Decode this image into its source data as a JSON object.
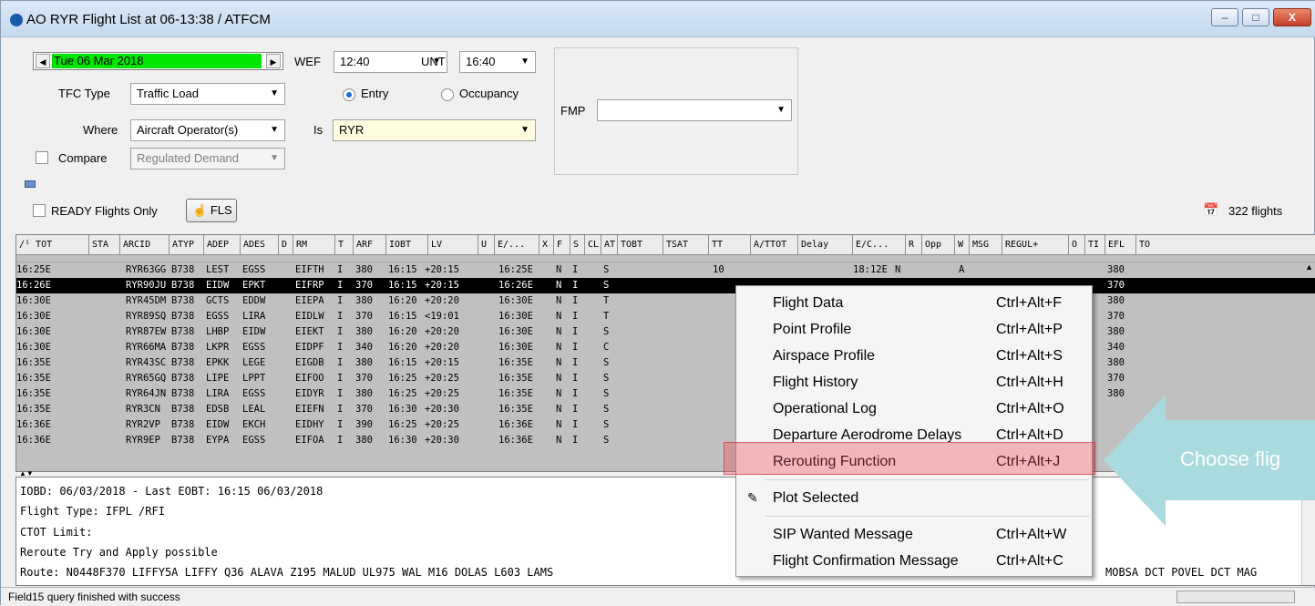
{
  "window": {
    "title": "AO RYR Flight List at 06-13:38 / ATFCM"
  },
  "filters": {
    "date": "Tue 06 Mar 2018",
    "wef_label": "WEF",
    "wef_value": "12:40",
    "unt_label": "UNT",
    "unt_value": "16:40",
    "tfc_type_label": "TFC Type",
    "tfc_type_value": "Traffic Load",
    "entry_label": "Entry",
    "occupancy_label": "Occupancy",
    "where_label": "Where",
    "where_value": "Aircraft Operator(s)",
    "is_label": "Is",
    "is_value": "RYR",
    "compare_label": "Compare",
    "compare_value": "Regulated Demand",
    "fmp_label": "FMP",
    "fmp_value": ""
  },
  "toolbar": {
    "ready_flights_label": "READY Flights Only",
    "fls_label": "FLS",
    "flight_count": "322 flights"
  },
  "columns": [
    "/¹ TOT",
    "STA",
    "ARCID",
    "ATYP",
    "ADEP",
    "ADES",
    "D",
    "RM",
    "T",
    "ARF",
    "IOBT",
    "LV",
    "U",
    "E/...",
    "X",
    "F",
    "S",
    "CL",
    "AT",
    "TOBT",
    "TSAT",
    "TT",
    "A/TTOT",
    "Delay",
    "E/C...",
    "R",
    "Opp",
    "W",
    "MSG",
    "REGUL+",
    "O",
    "TI",
    "EFL",
    "TO"
  ],
  "rows": [
    {
      "tot": "16:25E",
      "arcid": "RYR63GG",
      "atyp": "B738",
      "adep": "LEST",
      "ades": "EGSS",
      "rm": "EIFTH",
      "t": "I",
      "arf": "380",
      "iobt": "16:15",
      "lv": "+20:15",
      "e": "16:25E",
      "f": "N",
      "s": "I",
      "at": "S",
      "tt": "10",
      "ec": "18:12E",
      "r": "N",
      "w": "A",
      "efl": "380"
    },
    {
      "tot": "16:26E",
      "arcid": "RYR90JU",
      "atyp": "B738",
      "adep": "EIDW",
      "ades": "EPKT",
      "rm": "EIFRP",
      "t": "I",
      "arf": "370",
      "iobt": "16:15",
      "lv": "+20:15",
      "e": "16:26E",
      "f": "N",
      "s": "I",
      "at": "S",
      "tt": "",
      "ec": "",
      "r": "",
      "w": "",
      "efl": "370"
    },
    {
      "tot": "16:30E",
      "arcid": "RYR45DM",
      "atyp": "B738",
      "adep": "GCTS",
      "ades": "EDDW",
      "rm": "EIEPA",
      "t": "I",
      "arf": "380",
      "iobt": "16:20",
      "lv": "+20:20",
      "e": "16:30E",
      "f": "N",
      "s": "I",
      "at": "T",
      "tt": "",
      "ec": "",
      "r": "",
      "w": "",
      "efl": "380"
    },
    {
      "tot": "16:30E",
      "arcid": "RYR89SQ",
      "atyp": "B738",
      "adep": "EGSS",
      "ades": "LIRA",
      "rm": "EIDLW",
      "t": "I",
      "arf": "370",
      "iobt": "16:15",
      "lv": "<19:01",
      "e": "16:30E",
      "f": "N",
      "s": "I",
      "at": "T",
      "tt": "",
      "ec": "",
      "r": "",
      "w": "",
      "efl": "370"
    },
    {
      "tot": "16:30E",
      "arcid": "RYR87EW",
      "atyp": "B738",
      "adep": "LHBP",
      "ades": "EIDW",
      "rm": "EIEKT",
      "t": "I",
      "arf": "380",
      "iobt": "16:20",
      "lv": "+20:20",
      "e": "16:30E",
      "f": "N",
      "s": "I",
      "at": "S",
      "tt": "",
      "ec": "",
      "r": "",
      "w": "",
      "efl": "380"
    },
    {
      "tot": "16:30E",
      "arcid": "RYR66MA",
      "atyp": "B738",
      "adep": "LKPR",
      "ades": "EGSS",
      "rm": "EIDPF",
      "t": "I",
      "arf": "340",
      "iobt": "16:20",
      "lv": "+20:20",
      "e": "16:30E",
      "f": "N",
      "s": "I",
      "at": "C",
      "tt": "",
      "ec": "",
      "r": "",
      "w": "",
      "efl": "340"
    },
    {
      "tot": "16:35E",
      "arcid": "RYR43SC",
      "atyp": "B738",
      "adep": "EPKK",
      "ades": "LEGE",
      "rm": "EIGDB",
      "t": "I",
      "arf": "380",
      "iobt": "16:15",
      "lv": "+20:15",
      "e": "16:35E",
      "f": "N",
      "s": "I",
      "at": "S",
      "tt": "",
      "ec": "",
      "r": "",
      "w": "",
      "efl": "380"
    },
    {
      "tot": "16:35E",
      "arcid": "RYR65GQ",
      "atyp": "B738",
      "adep": "LIPE",
      "ades": "LPPT",
      "rm": "EIFOO",
      "t": "I",
      "arf": "370",
      "iobt": "16:25",
      "lv": "+20:25",
      "e": "16:35E",
      "f": "N",
      "s": "I",
      "at": "S",
      "tt": "",
      "ec": "",
      "r": "",
      "w": "",
      "efl": "370"
    },
    {
      "tot": "16:35E",
      "arcid": "RYR64JN",
      "atyp": "B738",
      "adep": "LIRA",
      "ades": "EGSS",
      "rm": "EIDYR",
      "t": "I",
      "arf": "380",
      "iobt": "16:25",
      "lv": "+20:25",
      "e": "16:35E",
      "f": "N",
      "s": "I",
      "at": "S",
      "tt": "",
      "ec": "",
      "r": "",
      "w": "",
      "efl": "380"
    },
    {
      "tot": "16:35E",
      "arcid": "RYR3CN",
      "atyp": "B738",
      "adep": "EDSB",
      "ades": "LEAL",
      "rm": "EIEFN",
      "t": "I",
      "arf": "370",
      "iobt": "16:30",
      "lv": "+20:30",
      "e": "16:35E",
      "f": "N",
      "s": "I",
      "at": "S",
      "tt": "",
      "ec": "",
      "r": "",
      "w": "",
      "efl": ""
    },
    {
      "tot": "16:36E",
      "arcid": "RYR2VP",
      "atyp": "B738",
      "adep": "EIDW",
      "ades": "EKCH",
      "rm": "EIDHY",
      "t": "I",
      "arf": "390",
      "iobt": "16:25",
      "lv": "+20:25",
      "e": "16:36E",
      "f": "N",
      "s": "I",
      "at": "S",
      "tt": "",
      "ec": "",
      "r": "",
      "w": "",
      "efl": ""
    },
    {
      "tot": "16:36E",
      "arcid": "RYR9EP",
      "atyp": "B738",
      "adep": "EYPA",
      "ades": "EGSS",
      "rm": "EIFOA",
      "t": "I",
      "arf": "380",
      "iobt": "16:30",
      "lv": "+20:30",
      "e": "16:36E",
      "f": "N",
      "s": "I",
      "at": "S",
      "tt": "",
      "ec": "",
      "r": "",
      "w": "",
      "efl": ""
    }
  ],
  "details": {
    "line1": "IOBD: 06/03/2018 - Last EOBT: 16:15 06/03/2018",
    "line2": "Flight Type: IFPL /RFI",
    "line3": "CTOT Limit:",
    "line4": "Reroute Try and Apply possible",
    "line5": "Route: N0448F370 LIFFY5A LIFFY Q36 ALAVA Z195 MALUD UL975 WAL M16 DOLAS L603 LAMS",
    "line5_tail": "MOBSA DCT POVEL DCT MAG"
  },
  "status": {
    "text": "Field15 query finished with success"
  },
  "context_menu": {
    "items": [
      {
        "label": "Flight Data",
        "shortcut": "Ctrl+Alt+F"
      },
      {
        "label": "Point Profile",
        "shortcut": "Ctrl+Alt+P"
      },
      {
        "label": "Airspace Profile",
        "shortcut": "Ctrl+Alt+S"
      },
      {
        "label": "Flight History",
        "shortcut": "Ctrl+Alt+H"
      },
      {
        "label": "Operational Log",
        "shortcut": "Ctrl+Alt+O"
      },
      {
        "label": "Departure Aerodrome Delays",
        "shortcut": "Ctrl+Alt+D"
      },
      {
        "label": "Rerouting Function",
        "shortcut": "Ctrl+Alt+J"
      },
      {
        "label": "Plot Selected",
        "shortcut": ""
      },
      {
        "label": "SIP Wanted Message",
        "shortcut": "Ctrl+Alt+W"
      },
      {
        "label": "Flight Confirmation Message",
        "shortcut": "Ctrl+Alt+C"
      }
    ]
  },
  "callout": {
    "text": "Choose flig"
  },
  "colors": {
    "date_bg": "#00e600",
    "is_field_bg": "#fffde0",
    "highlight": "#eb4650",
    "callout": "#a9dadd"
  }
}
